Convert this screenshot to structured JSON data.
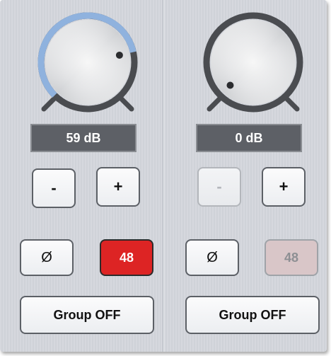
{
  "channels": [
    {
      "gain_value": 59,
      "gain_label": "59 dB",
      "minus_label": "-",
      "plus_label": "+",
      "phase_label": "Ø",
      "phantom_label": "48",
      "phantom_on": true,
      "minus_enabled": true,
      "group_label": "Group OFF"
    },
    {
      "gain_value": 0,
      "gain_label": "0 dB",
      "minus_label": "-",
      "plus_label": "+",
      "phase_label": "Ø",
      "phantom_label": "48",
      "phantom_on": false,
      "minus_enabled": false,
      "group_label": "Group OFF"
    }
  ],
  "colors": {
    "knob_ring": "#4a4c50",
    "knob_arc_active": "#8fb2de",
    "display_bg": "#5d6066",
    "phantom_on": "#dd2424",
    "phantom_off": "#d9c6c8",
    "panel_bg": "#d3d6dc"
  }
}
